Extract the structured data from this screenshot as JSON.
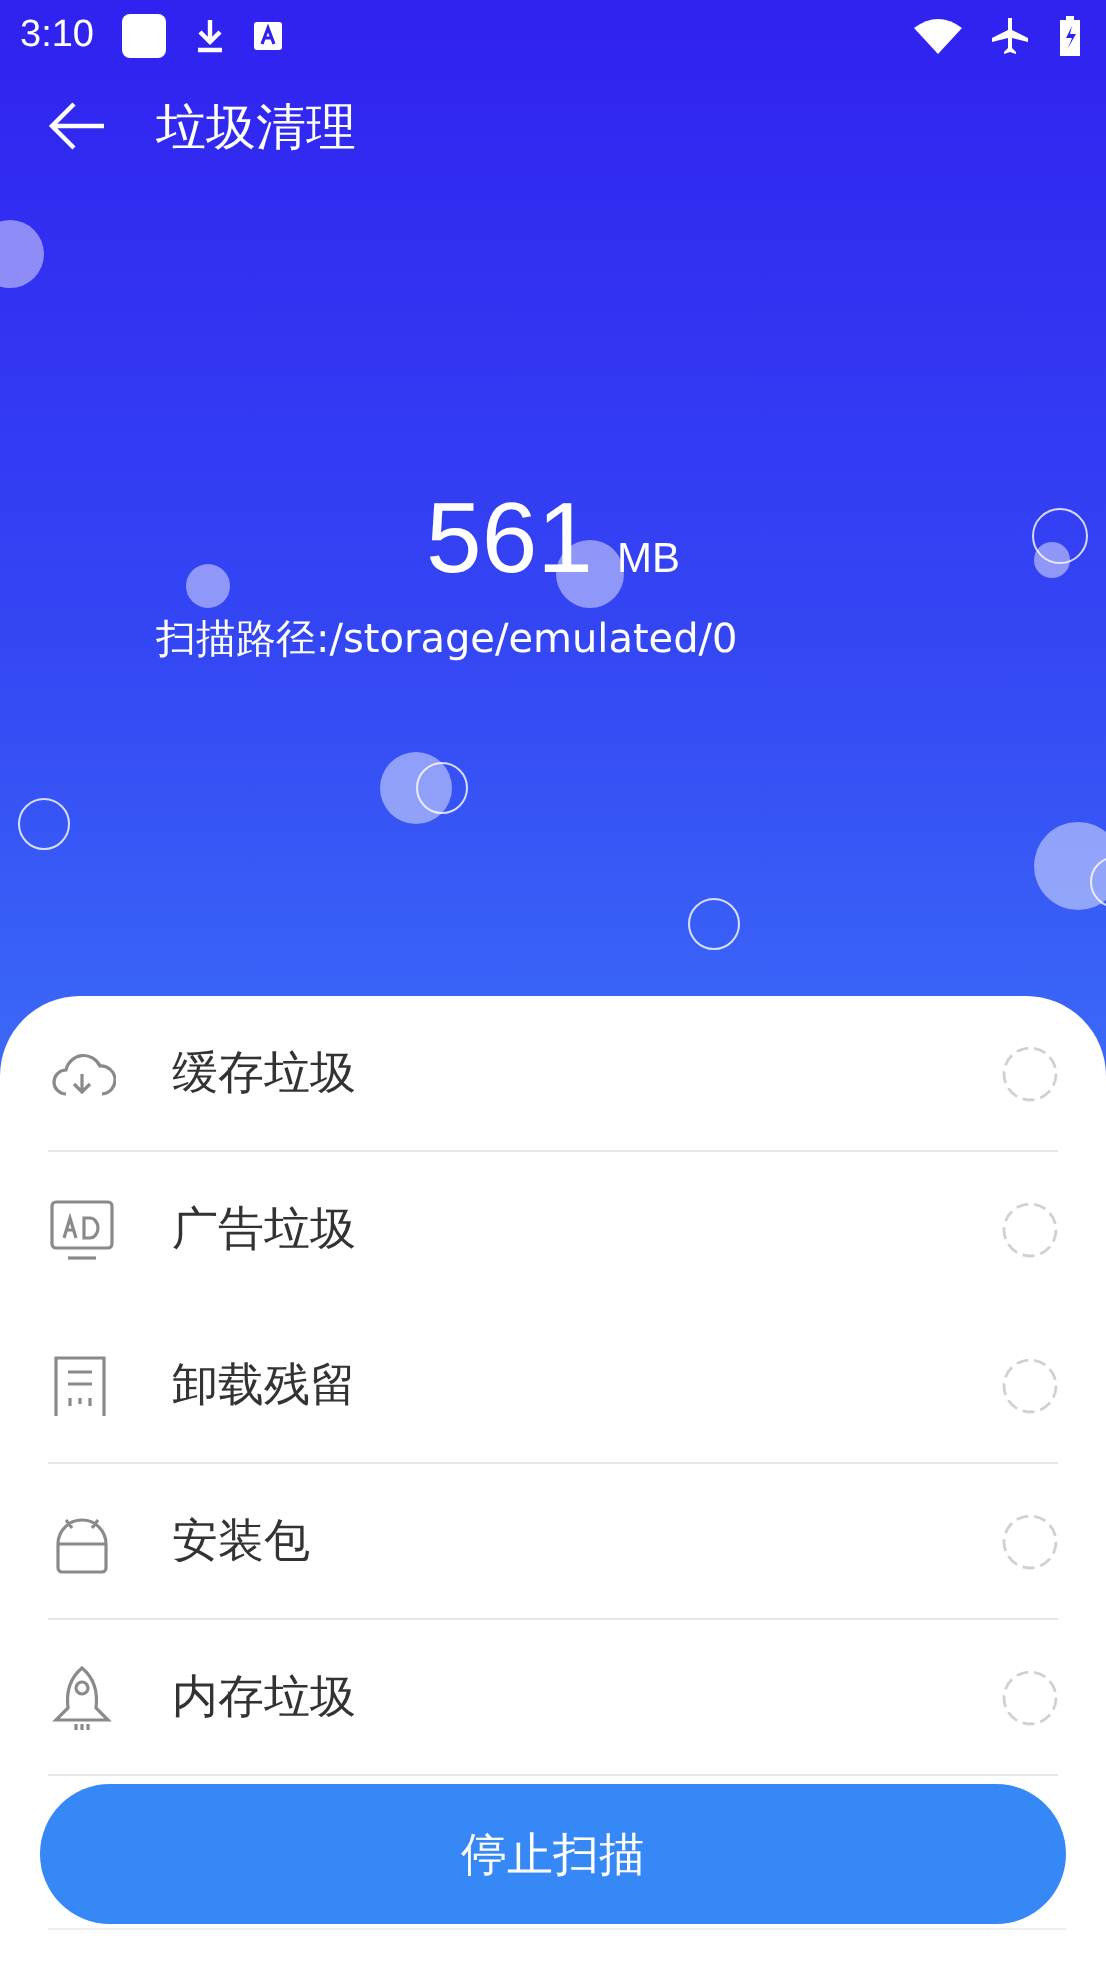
{
  "status_bar": {
    "time": "3:10"
  },
  "header": {
    "title": "垃圾清理"
  },
  "scan": {
    "size": "561",
    "unit": "MB",
    "path": "扫描路径:/storage/emulated/0"
  },
  "items": [
    {
      "kind": "cache",
      "label": "缓存垃圾",
      "divider": true
    },
    {
      "kind": "ad",
      "label": "广告垃圾",
      "divider": false
    },
    {
      "kind": "residue",
      "label": "卸载残留",
      "divider": true
    },
    {
      "kind": "apk",
      "label": "安装包",
      "divider": true
    },
    {
      "kind": "memory",
      "label": "内存垃圾",
      "divider": true
    }
  ],
  "button": {
    "label": "停止扫描"
  }
}
